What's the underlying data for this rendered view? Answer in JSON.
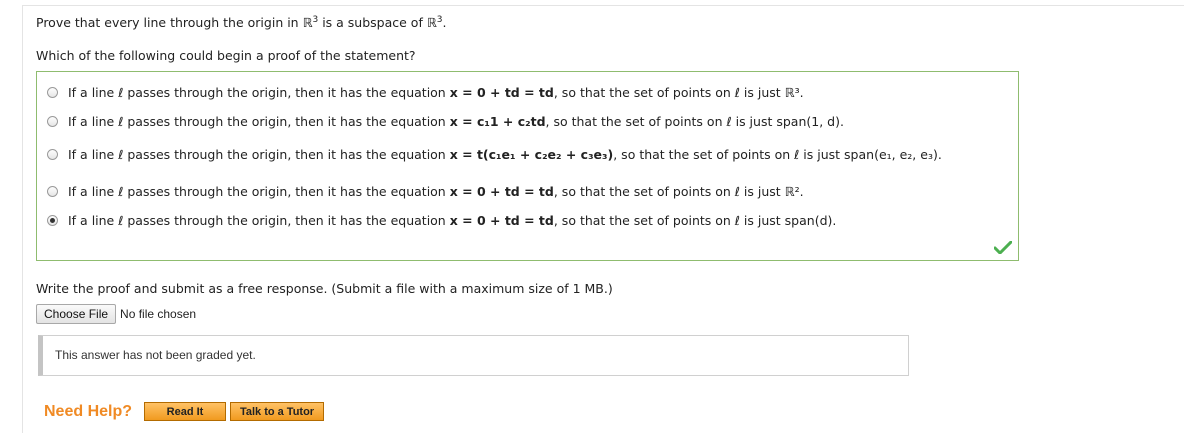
{
  "question": {
    "pre": "Prove that every line through the origin in ",
    "space1": "ℝ",
    "sup1": "3",
    "mid": " is a subspace of ",
    "space2": "ℝ",
    "sup2": "3",
    "post": "."
  },
  "prompt": "Which of the following could begin a proof of the statement?",
  "common": {
    "intro": "If a line ℓ passes through the origin, then it has the equation ",
    "so": ", so that the set of points on ℓ is just "
  },
  "options": [
    {
      "eq": "x = 0 + td = td",
      "set": "ℝ³."
    },
    {
      "eq": "x = c₁1 + c₂td",
      "set": "span(1, d)."
    },
    {
      "eq": "x = t(c₁e₁ + c₂e₂ + c₃e₃)",
      "set": "span(e₁, e₂, e₃)."
    },
    {
      "eq": "x = 0 + td = td",
      "set": "ℝ²."
    },
    {
      "eq": "x = 0 + td = td",
      "set": "span(d)."
    }
  ],
  "selected_index": 4,
  "correct_icon": "checkmark-icon",
  "colors": {
    "correct": "#4caf50",
    "border": "#8fbc6f",
    "help": "#f08a24"
  },
  "write_prompt": "Write the proof and submit as a free response. (Submit a file with a maximum size of 1 MB.)",
  "file": {
    "button_label": "Choose File",
    "status": "No file chosen"
  },
  "graded_status": "This answer has not been graded yet.",
  "help": {
    "label": "Need Help?",
    "read_label": "Read It",
    "tutor_label": "Talk to a Tutor"
  }
}
